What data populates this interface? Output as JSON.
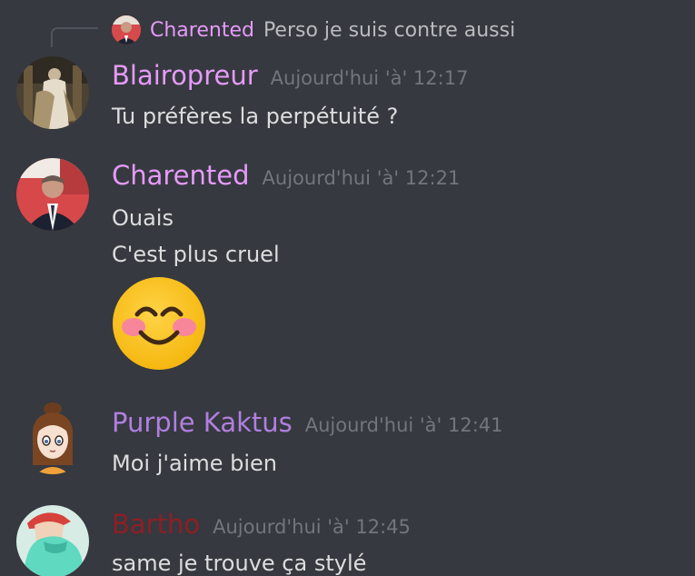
{
  "reply": {
    "author": "Charented",
    "text": "Perso je suis contre aussi"
  },
  "messages": [
    {
      "author": "Blairopreur",
      "author_color": "#e59bf8",
      "timestamp": "Aujourd'hui 'à' 12:17",
      "lines": [
        "Tu préfères la perpétuité ?"
      ]
    },
    {
      "author": "Charented",
      "author_color": "#e59bf8",
      "timestamp": "Aujourd'hui 'à' 12:21",
      "lines": [
        "Ouais",
        "C'est plus cruel"
      ],
      "emoji": "blush-smile-emoji"
    },
    {
      "author": "Purple Kaktus",
      "author_color": "#b17fe0",
      "timestamp": "Aujourd'hui 'à' 12:41",
      "lines": [
        "Moi j'aime bien"
      ]
    },
    {
      "author": "Bartho",
      "author_color": "#8c1f24",
      "timestamp": "Aujourd'hui 'à' 12:45",
      "lines": [
        "same je trouve ça stylé"
      ]
    }
  ]
}
